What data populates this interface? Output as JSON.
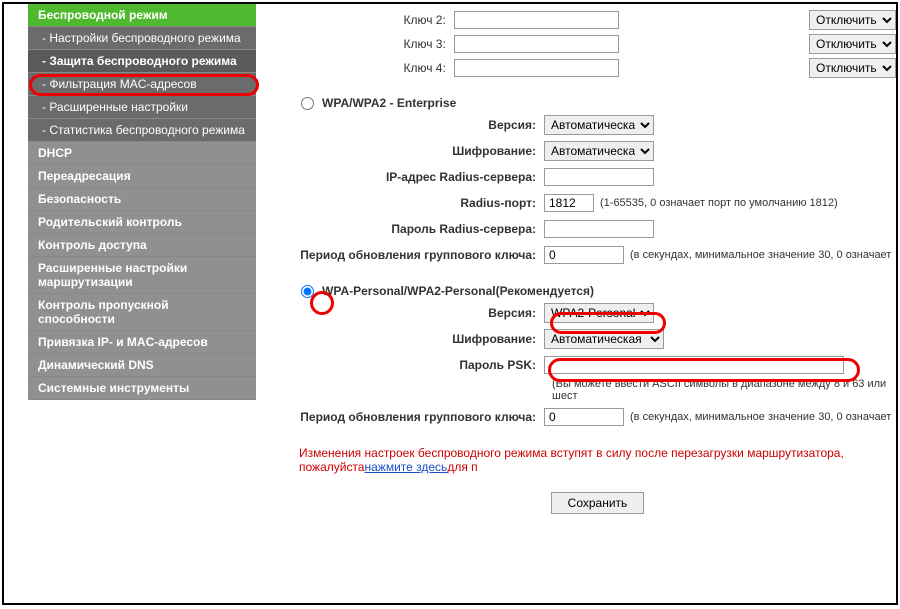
{
  "sidebar": {
    "items": [
      {
        "label": "Беспроводной режим",
        "cls": "menu-active"
      },
      {
        "label": "- Настройки беспроводного режима",
        "cls": "menu-sub"
      },
      {
        "label": "- Защита беспроводного режима",
        "cls": "menu-sub menu-selected"
      },
      {
        "label": "- Фильтрация MAC-адресов",
        "cls": "menu-sub"
      },
      {
        "label": "- Расширенные настройки",
        "cls": "menu-sub"
      },
      {
        "label": "- Статистика беспроводного режима",
        "cls": "menu-sub"
      },
      {
        "label": "DHCP",
        "cls": "menu-top"
      },
      {
        "label": "Переадресация",
        "cls": "menu-top"
      },
      {
        "label": "Безопасность",
        "cls": "menu-top"
      },
      {
        "label": "Родительский контроль",
        "cls": "menu-top"
      },
      {
        "label": "Контроль доступа",
        "cls": "menu-top"
      },
      {
        "label": "Расширенные настройки маршрутизации",
        "cls": "menu-top"
      },
      {
        "label": "Контроль пропускной способности",
        "cls": "menu-top"
      },
      {
        "label": "Привязка IP- и MAC-адресов",
        "cls": "menu-top"
      },
      {
        "label": "Динамический DNS",
        "cls": "menu-top"
      },
      {
        "label": "Системные инструменты",
        "cls": "menu-top"
      }
    ]
  },
  "keys": [
    {
      "label": "Ключ 2:",
      "disable": "Отключить"
    },
    {
      "label": "Ключ 3:",
      "disable": "Отключить"
    },
    {
      "label": "Ключ 4:",
      "disable": "Отключить"
    }
  ],
  "enterprise": {
    "title": "WPA/WPA2 - Enterprise",
    "version_label": "Версия:",
    "version_val": "Автоматическая",
    "enc_label": "Шифрование:",
    "enc_val": "Автоматическая",
    "radius_ip_label": "IP-адрес Radius-сервера:",
    "radius_ip_val": "",
    "radius_port_label": "Radius-порт:",
    "radius_port_val": "1812",
    "radius_port_hint": "(1-65535, 0 означает порт по умолчанию 1812)",
    "radius_pw_label": "Пароль Radius-сервера:",
    "radius_pw_val": "",
    "gk_label": "Период обновления группового ключа:",
    "gk_val": "0",
    "gk_hint": "(в секундах, минимальное значение 30, 0 означает"
  },
  "personal": {
    "title": "WPA-Personal/WPA2-Personal(Рекомендуется)",
    "version_label": "Версия:",
    "version_val": "WPA2-Personal",
    "enc_label": "Шифрование:",
    "enc_val": "Автоматическая",
    "psk_label": "Пароль PSK:",
    "psk_val": "",
    "psk_hint": "(Вы можете ввести ASCII символы в диапазоне между 8 и 63 или шест",
    "gk_label": "Период обновления группового ключа:",
    "gk_val": "0",
    "gk_hint": "(в секундах, минимальное значение 30, 0 означает"
  },
  "warning": {
    "prefix": "Изменения настроек беспроводного режима вступят в силу после перезагрузки маршрутизатора, пожалуйста",
    "link": "нажмите здесь",
    "suffix": "для п"
  },
  "save": "Сохранить"
}
